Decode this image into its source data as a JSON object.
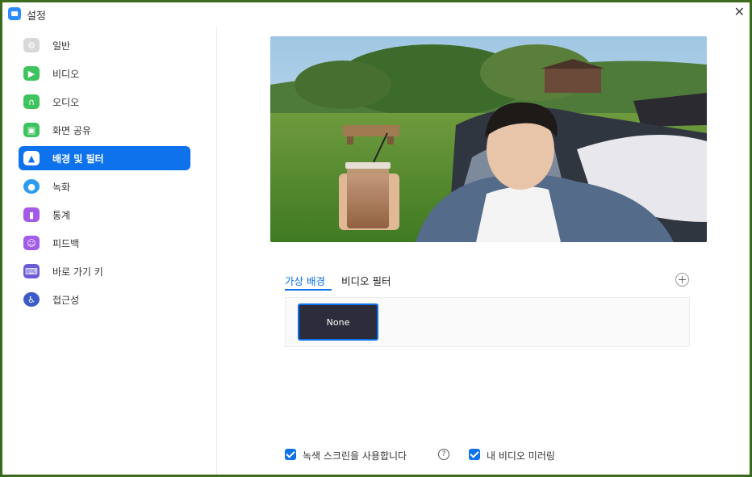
{
  "window": {
    "title": "설정",
    "close_glyph": "✕"
  },
  "sidebar": {
    "items": [
      {
        "label": "일반",
        "icon": "gear-icon",
        "color": "#d8d8d8",
        "glyph": "⚙"
      },
      {
        "label": "비디오",
        "icon": "video-icon",
        "color": "#3fc35f",
        "glyph": "▶"
      },
      {
        "label": "오디오",
        "icon": "headphones-icon",
        "color": "#3fc35f",
        "glyph": "∩"
      },
      {
        "label": "화면 공유",
        "icon": "screen-share-icon",
        "color": "#3fc35f",
        "glyph": "▣"
      },
      {
        "label": "배경 및 필터",
        "icon": "background-icon",
        "color": "#ffffff",
        "glyph": "▲",
        "active": true
      },
      {
        "label": "녹화",
        "icon": "record-icon",
        "color": "#2d9cf0",
        "glyph": "●"
      },
      {
        "label": "통계",
        "icon": "statistics-icon",
        "color": "#a35be8",
        "glyph": "▮"
      },
      {
        "label": "피드백",
        "icon": "feedback-icon",
        "color": "#a35be8",
        "glyph": "☺"
      },
      {
        "label": "바로 가기 키",
        "icon": "keyboard-icon",
        "color": "#6b5bd6",
        "glyph": "⌨"
      },
      {
        "label": "접근성",
        "icon": "accessibility-icon",
        "color": "#3c5bc8",
        "glyph": "♿"
      }
    ]
  },
  "main": {
    "tabs": [
      {
        "label": "가상 배경",
        "active": true
      },
      {
        "label": "비디오 필터",
        "active": false
      }
    ],
    "add_button_icon": "plus-icon",
    "background_options": [
      {
        "label": "None",
        "selected": true
      }
    ],
    "checkboxes": [
      {
        "label": "녹색 스크린을 사용합니다",
        "checked": true
      },
      {
        "label": "내 비디오 미러링",
        "checked": true
      }
    ],
    "help_glyph": "?"
  },
  "colors": {
    "accent": "#0e72ed",
    "frame_border": "#3c6b1e"
  }
}
